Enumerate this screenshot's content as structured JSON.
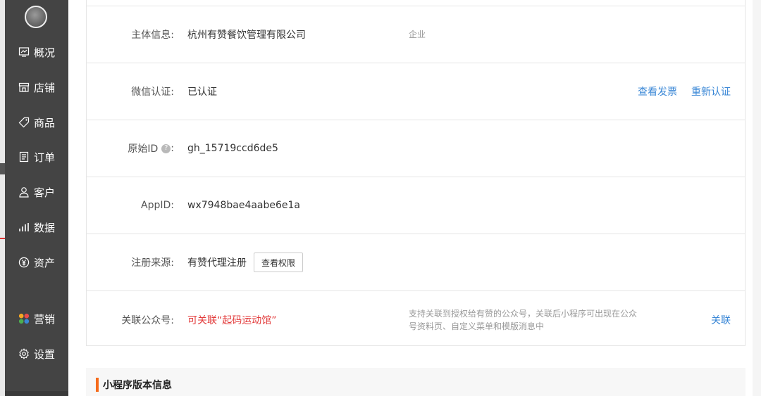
{
  "sidebar": {
    "items": [
      {
        "label": "概况",
        "icon": "overview-icon"
      },
      {
        "label": "店铺",
        "icon": "store-icon"
      },
      {
        "label": "商品",
        "icon": "tag-icon"
      },
      {
        "label": "订单",
        "icon": "order-icon"
      },
      {
        "label": "客户",
        "icon": "customer-icon"
      },
      {
        "label": "数据",
        "icon": "chart-icon"
      },
      {
        "label": "资产",
        "icon": "yen-icon"
      },
      {
        "label": "营销",
        "icon": "marketing-icon"
      },
      {
        "label": "设置",
        "icon": "gear-icon"
      }
    ]
  },
  "info": {
    "subject": {
      "label": "主体信息:",
      "value": "杭州有赞餐饮管理有限公司",
      "note": "企业"
    },
    "wechat": {
      "label": "微信认证:",
      "value": "已认证",
      "action1": "查看发票",
      "action2": "重新认证"
    },
    "original_id": {
      "label": "原始ID",
      "colon": ":",
      "value": "gh_15719ccd6de5"
    },
    "appid": {
      "label": "AppID:",
      "value": "wx7948bae4aabe6e1a"
    },
    "source": {
      "label": "注册来源:",
      "value": "有赞代理注册",
      "button": "查看权限"
    },
    "official": {
      "label": "关联公众号:",
      "value": "可关联“起码运动馆”",
      "note": "支持关联到授权给有赞的公众号，关联后小程序可出现在公众号资料页、自定义菜单和模版消息中",
      "action": "关联"
    }
  },
  "version_section": {
    "title": "小程序版本信息"
  },
  "colors": {
    "sidebar": "#444444",
    "link": "#3a87d6",
    "alert": "#e23a3a",
    "accent": "#f56a1a"
  }
}
